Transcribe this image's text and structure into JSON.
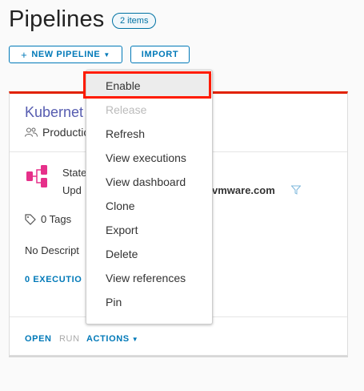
{
  "page": {
    "title": "Pipelines",
    "count_badge": "2 items"
  },
  "toolbar": {
    "new_pipeline_label": "NEW PIPELINE",
    "import_label": "IMPORT"
  },
  "card": {
    "title": "Kubernet",
    "project": "Productic",
    "state_label": "State",
    "updated_label": "Upd",
    "updated_by": "vmware.com",
    "tags": "0 Tags",
    "description": "No Descript",
    "executions": "0 EXECUTIO",
    "footer": {
      "open": "OPEN",
      "run": "RUN",
      "actions": "ACTIONS"
    }
  },
  "actions_menu": {
    "items": [
      {
        "label": "Enable",
        "state": "active"
      },
      {
        "label": "Release",
        "state": "disabled"
      },
      {
        "label": "Refresh",
        "state": "enabled"
      },
      {
        "label": "View executions",
        "state": "enabled"
      },
      {
        "label": "View dashboard",
        "state": "enabled"
      },
      {
        "label": "Clone",
        "state": "enabled"
      },
      {
        "label": "Export",
        "state": "enabled"
      },
      {
        "label": "Delete",
        "state": "enabled"
      },
      {
        "label": "View references",
        "state": "enabled"
      },
      {
        "label": "Pin",
        "state": "enabled"
      }
    ]
  },
  "colors": {
    "accent": "#0079b8",
    "card_top_border": "#e12200",
    "highlight": "#ff1b00",
    "pipeline_icon": "#e6308a",
    "card_title": "#565cb0"
  },
  "icons": {
    "plus": "+",
    "chevron_down": "⌄",
    "project": "users-icon",
    "pipeline": "pipeline-icon",
    "tag": "tag-icon",
    "filter": "filter-icon"
  }
}
